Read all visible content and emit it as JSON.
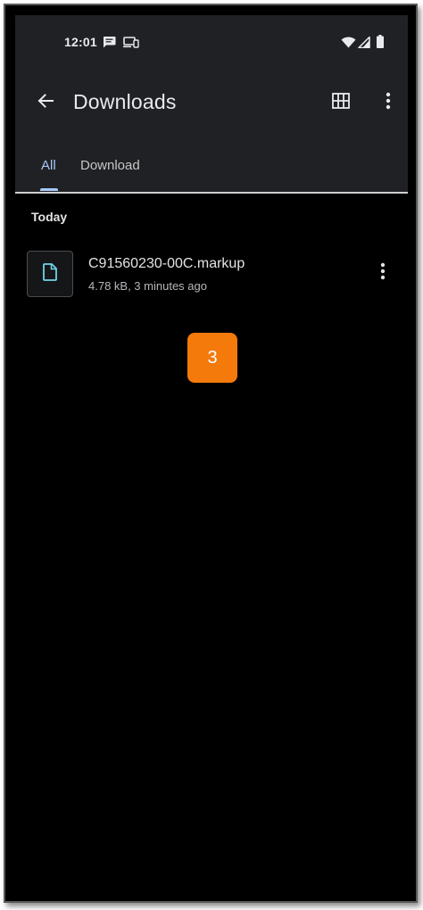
{
  "status_bar": {
    "time": "12:01",
    "icons": [
      "message-icon",
      "cast-icon",
      "wifi-icon",
      "signal-icon",
      "battery-icon"
    ]
  },
  "app_bar": {
    "title": "Downloads",
    "back_icon": "arrow-back-icon",
    "grid_icon": "grid-view-icon",
    "more_icon": "more-vert-icon"
  },
  "tabs": [
    {
      "label": "All",
      "selected": true
    },
    {
      "label": "Download",
      "selected": false
    }
  ],
  "sections": [
    {
      "header": "Today",
      "files": [
        {
          "name": "C91560230-00C.markup",
          "meta": "4.78 kB, 3 minutes ago",
          "icon": "file-icon"
        }
      ]
    }
  ],
  "badge": {
    "label": "3",
    "color": "#f47a0c"
  },
  "colors": {
    "accent": "#a8c7fa",
    "file_icon": "#6fd3e6",
    "topbar_bg": "#202124",
    "background": "#000000"
  }
}
